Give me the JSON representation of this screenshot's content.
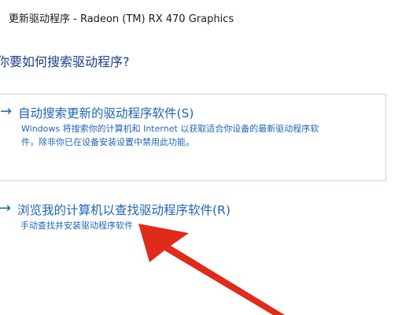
{
  "window": {
    "title": "更新驱动程序 - Radeon (TM) RX 470 Graphics"
  },
  "question": "你要如何搜索驱动程序?",
  "options": [
    {
      "arrow": "→",
      "title": "自动搜索更新的驱动程序软件(S)",
      "description_lines": [
        "Windows 将搜索你的计算机和 Internet 以获取适合你设备的最新驱动程序软",
        "件，除非你已在设备安装设置中禁用此功能。"
      ]
    },
    {
      "arrow": "→",
      "title": "浏览我的计算机以查找驱动程序软件(R)",
      "description": "手动查找并安装驱动程序软件"
    }
  ],
  "colors": {
    "link_blue": "#1f64b8",
    "heading_blue": "#1c3e8c",
    "option_border": "#b9d6ee",
    "annotation_red": "#e02a1a"
  },
  "icons": {
    "option_arrow": "right-arrow-icon",
    "annotation": "red-pointer-arrow"
  }
}
